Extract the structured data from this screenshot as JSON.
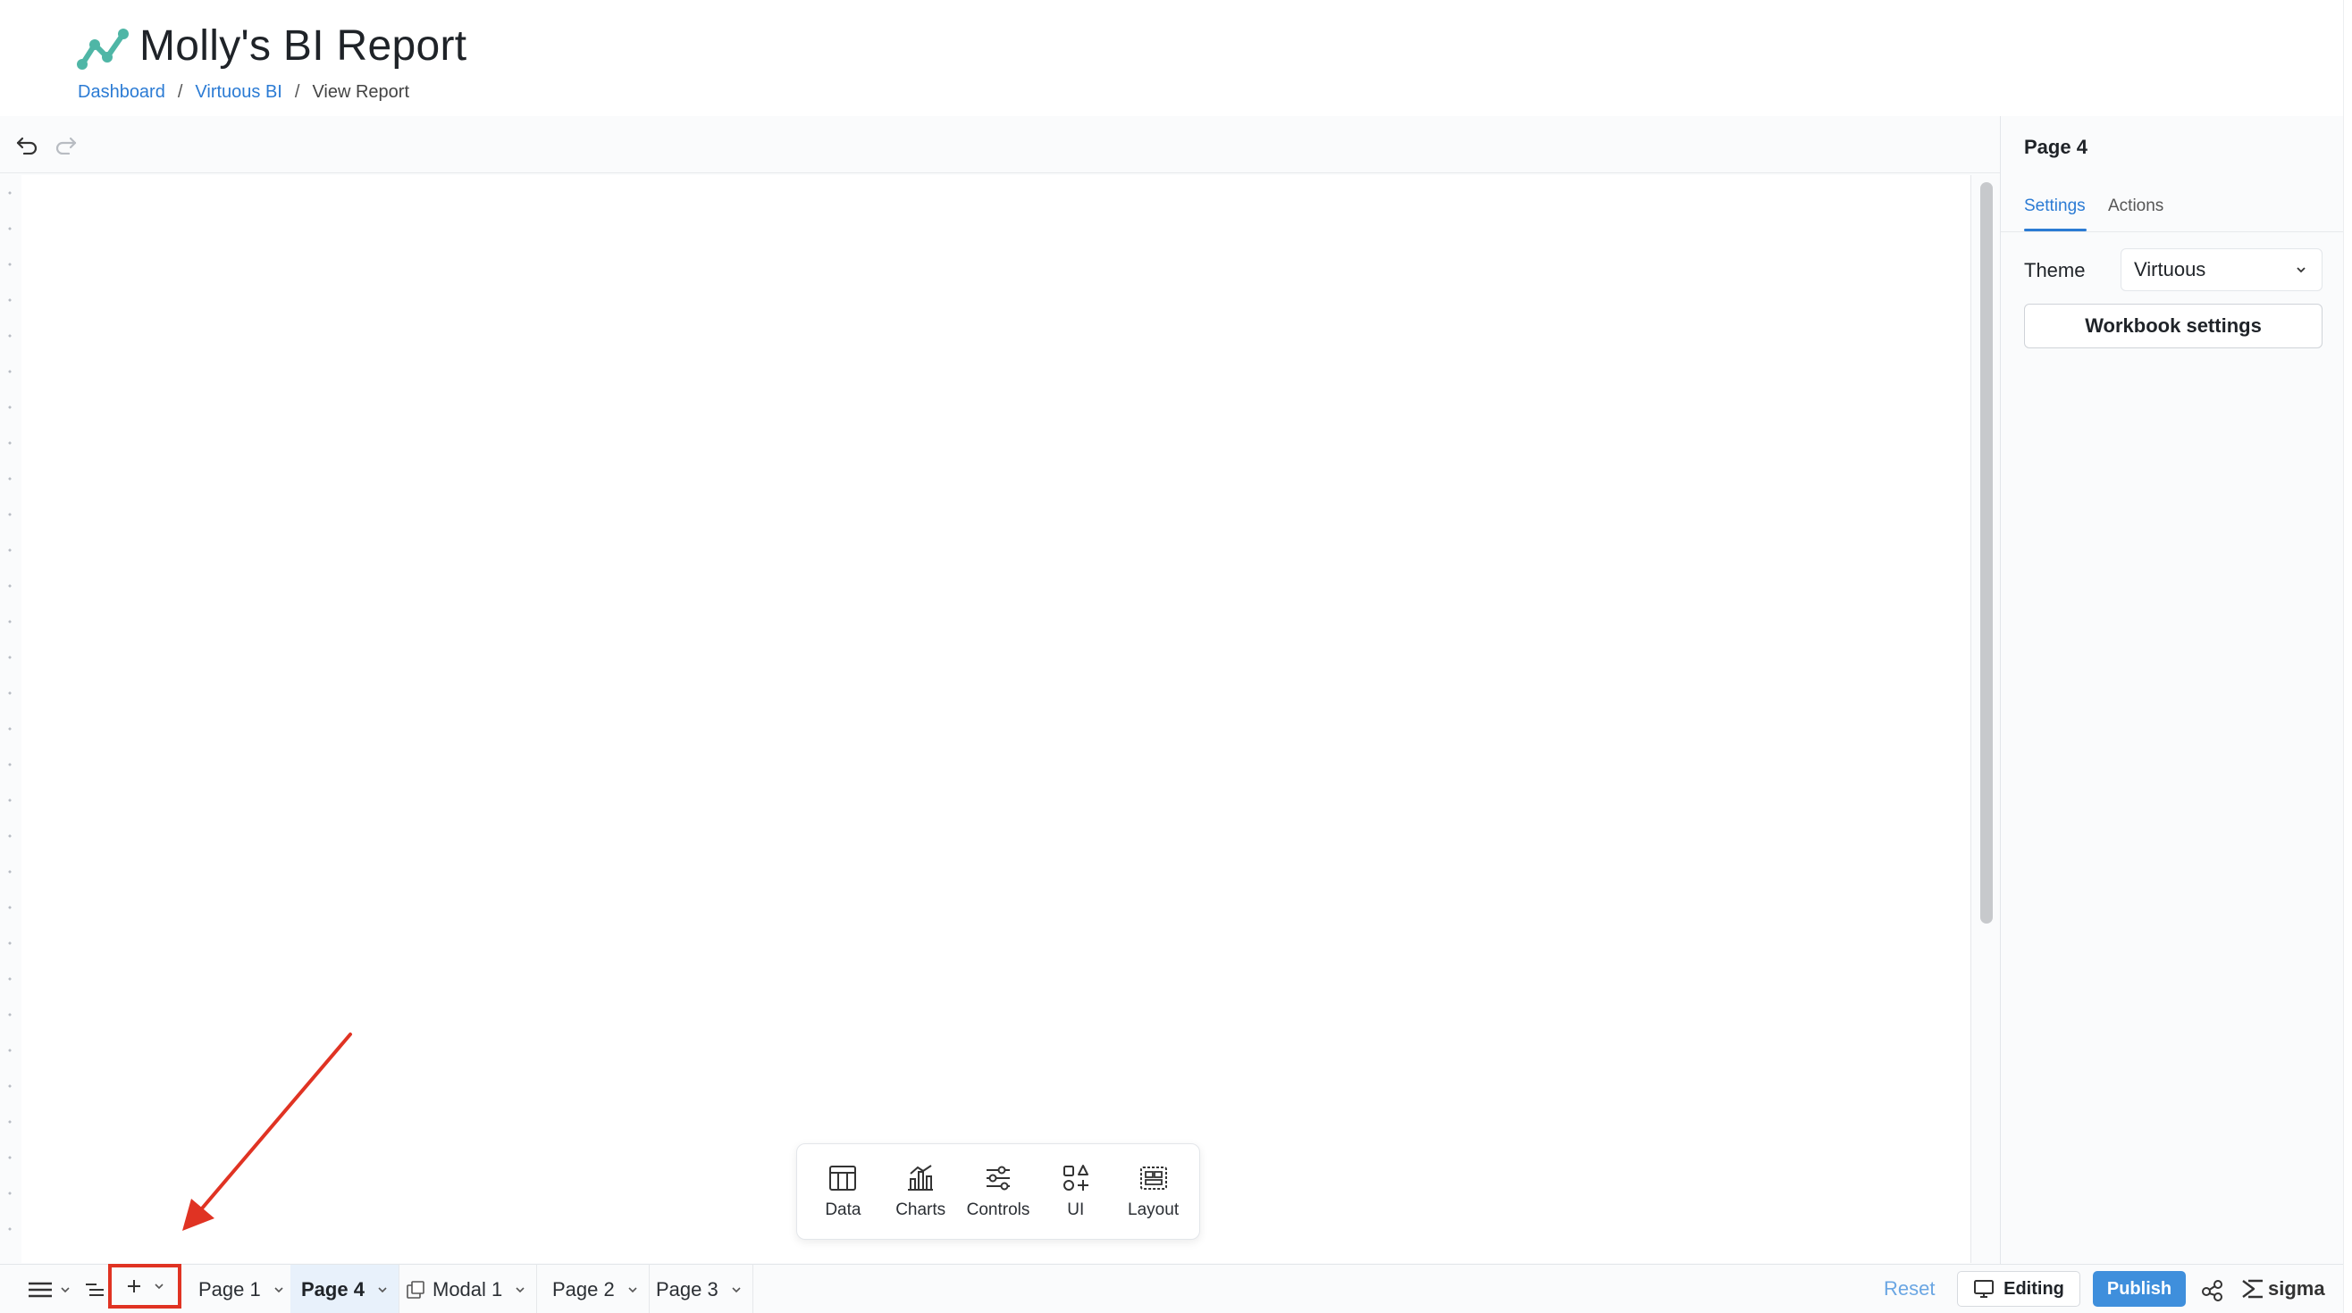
{
  "header": {
    "title": "Molly's BI Report",
    "logo_icon": "line-chart-icon",
    "breadcrumb": [
      "Dashboard",
      "Virtuous BI",
      "View Report"
    ]
  },
  "toolbar": {
    "undo_icon": "undo-icon",
    "redo_icon": "redo-icon"
  },
  "toolbox": {
    "items": [
      {
        "label": "Data",
        "icon": "table-icon"
      },
      {
        "label": "Charts",
        "icon": "chart-icon"
      },
      {
        "label": "Controls",
        "icon": "sliders-icon"
      },
      {
        "label": "UI",
        "icon": "shapes-icon"
      },
      {
        "label": "Layout",
        "icon": "layout-icon"
      }
    ]
  },
  "right_panel": {
    "title": "Page 4",
    "tabs": [
      "Settings",
      "Actions"
    ],
    "active_tab": "Settings",
    "theme_label": "Theme",
    "theme_value": "Virtuous",
    "workbook_settings_label": "Workbook settings"
  },
  "bottom_bar": {
    "pages": [
      {
        "label": "Page 1",
        "active": false
      },
      {
        "label": "Page 4",
        "active": true
      },
      {
        "label": "Modal 1",
        "active": false,
        "icon": "modal-icon"
      },
      {
        "label": "Page 2",
        "active": false
      },
      {
        "label": "Page 3",
        "active": false
      }
    ],
    "reset_label": "Reset",
    "editing_label": "Editing",
    "publish_label": "Publish",
    "brand": "sigma"
  },
  "colors": {
    "accent": "#2b7bd4",
    "publish": "#3f8fdc",
    "annotation": "#e03323",
    "logo": "#4fb6a6"
  }
}
